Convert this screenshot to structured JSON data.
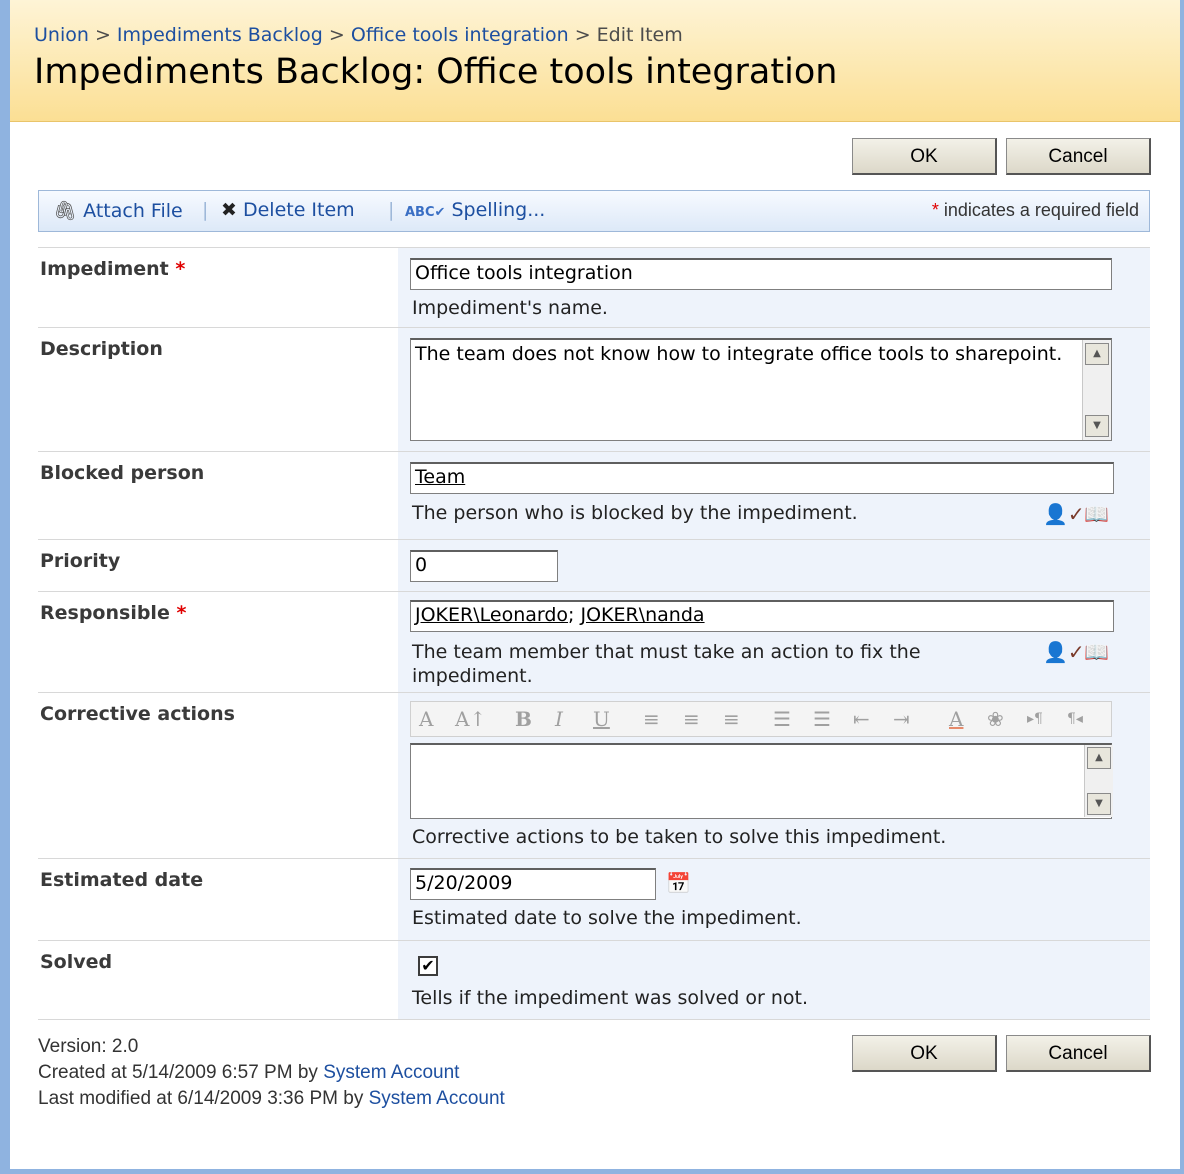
{
  "breadcrumb": {
    "items": [
      "Union",
      "Impediments Backlog",
      "Office tools integration"
    ],
    "current": "Edit Item",
    "separator": ">"
  },
  "page_title": "Impediments Backlog: Office tools integration",
  "buttons": {
    "ok": "OK",
    "cancel": "Cancel"
  },
  "toolbar": {
    "attach": "Attach File",
    "delete": "Delete Item",
    "spelling": "Spelling...",
    "required_star": "*",
    "required_note": "indicates a required field",
    "icons": {
      "attach": "paperclip-icon",
      "delete": "x-icon",
      "spelling": "spellcheck-icon"
    }
  },
  "fields": {
    "impediment": {
      "label": "Impediment",
      "required": "*",
      "value": "Office tools integration",
      "description": "Impediment's name."
    },
    "description": {
      "label": "Description",
      "value": "The team does not know how to integrate office tools to sharepoint."
    },
    "blocked_person": {
      "label": "Blocked person",
      "value": "Team",
      "description": "The person who is blocked by the impediment."
    },
    "priority": {
      "label": "Priority",
      "value": "0"
    },
    "responsible": {
      "label": "Responsible",
      "required": "*",
      "value_1": "JOKER\\Leonardo",
      "value_sep": ";",
      "value_2": "JOKER\\nanda",
      "description": "The team member that must take an action to fix the impediment."
    },
    "corrective_actions": {
      "label": "Corrective actions",
      "value": "",
      "description": "Corrective actions to be taken to solve this impediment."
    },
    "estimated_date": {
      "label": "Estimated date",
      "value": "5/20/2009",
      "description": "Estimated date to solve the impediment."
    },
    "solved": {
      "label": "Solved",
      "checked": true,
      "description": "Tells if the impediment was solved or not."
    }
  },
  "footer": {
    "version": "Version: 2.0",
    "created": "Created at 5/14/2009 6:57 PM  by",
    "created_by": "System Account",
    "modified": "Last modified at 6/14/2009 3:36 PM  by",
    "modified_by": "System Account"
  },
  "colors": {
    "header": "#fbdf94",
    "field_bg": "#eef3fb",
    "link": "#1d4fa0",
    "required": "#e00000"
  }
}
